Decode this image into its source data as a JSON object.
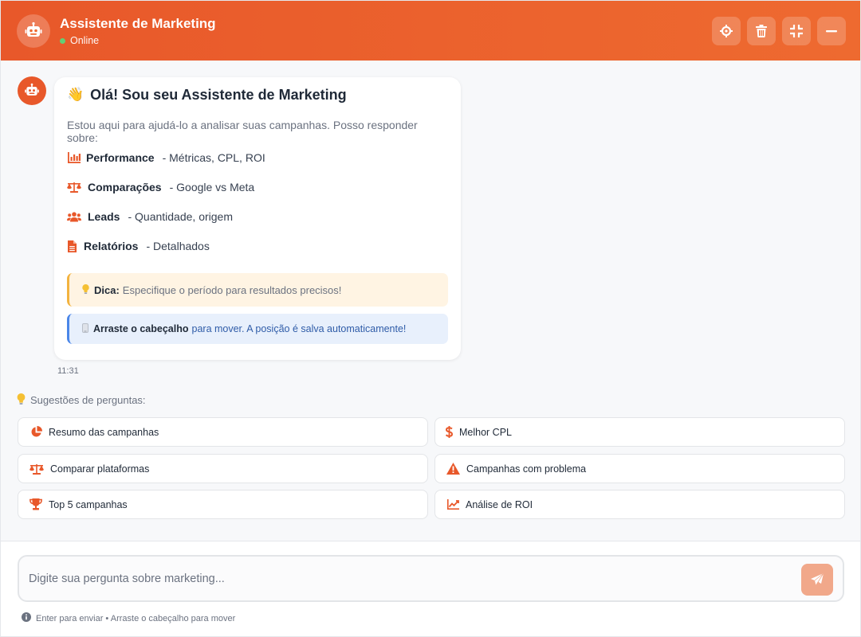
{
  "header": {
    "title": "Assistente de Marketing",
    "status": "Online",
    "actions": [
      "crosshair-icon",
      "trash-icon",
      "compress-icon",
      "minus-icon"
    ]
  },
  "message": {
    "title_emoji": "👋",
    "title": "Olá! Sou seu Assistente de Marketing",
    "intro": "Estou aqui para ajudá-lo a analisar suas campanhas. Posso responder sobre:",
    "topics": [
      {
        "name": "Performance",
        "desc": "- Métricas, CPL, ROI",
        "icon": "bar-chart-icon"
      },
      {
        "name": "Comparações",
        "desc": "- Google vs Meta",
        "icon": "balance-scale-icon"
      },
      {
        "name": "Leads",
        "desc": "- Quantidade, origem",
        "icon": "users-icon"
      },
      {
        "name": "Relatórios",
        "desc": "- Detalhados",
        "icon": "file-icon"
      }
    ],
    "tip_label": "Dica:",
    "tip_text": "Especifique o período para resultados precisos!",
    "drag_label": "Arraste o cabeçalho",
    "drag_text": "para mover. A posição é salva automaticamente!",
    "time": "11:31"
  },
  "suggestions": {
    "heading": "Sugestões de perguntas:",
    "items": [
      {
        "label": "Resumo das campanhas",
        "icon": "pie-chart-icon"
      },
      {
        "label": "Melhor CPL",
        "icon": "dollar-icon"
      },
      {
        "label": "Comparar plataformas",
        "icon": "balance-scale-icon"
      },
      {
        "label": "Campanhas com problema",
        "icon": "warning-icon"
      },
      {
        "label": "Top 5 campanhas",
        "icon": "trophy-icon"
      },
      {
        "label": "Análise de ROI",
        "icon": "line-chart-icon"
      }
    ]
  },
  "input": {
    "placeholder": "Digite sua pergunta sobre marketing...",
    "value": "",
    "hint": "Enter para enviar • Arraste o cabeçalho para mover"
  },
  "colors": {
    "accent": "#e8582a",
    "send_disabled": "#f1a88a",
    "online": "#5bd67a"
  }
}
